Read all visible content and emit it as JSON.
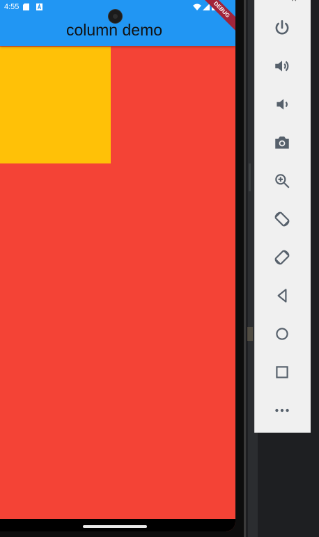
{
  "status_bar": {
    "time": "4:55"
  },
  "app_bar": {
    "title": "column demo",
    "debug_banner": "DEBUG",
    "color": "#2196f3"
  },
  "body": {
    "background_color": "#f44336",
    "box_color": "#ffc107"
  },
  "emulator_controls": {
    "items": [
      {
        "name": "power",
        "icon": "power-icon"
      },
      {
        "name": "volume up",
        "icon": "volume-up-icon"
      },
      {
        "name": "volume down",
        "icon": "volume-down-icon"
      },
      {
        "name": "screenshot",
        "icon": "camera-icon"
      },
      {
        "name": "zoom",
        "icon": "zoom-in-icon"
      },
      {
        "name": "rotate left",
        "icon": "rotate-left-icon"
      },
      {
        "name": "rotate right",
        "icon": "rotate-right-icon"
      },
      {
        "name": "back",
        "icon": "back-triangle-icon"
      },
      {
        "name": "home",
        "icon": "home-circle-icon"
      },
      {
        "name": "overview",
        "icon": "overview-square-icon"
      },
      {
        "name": "more",
        "icon": "more-dots-icon"
      }
    ]
  }
}
